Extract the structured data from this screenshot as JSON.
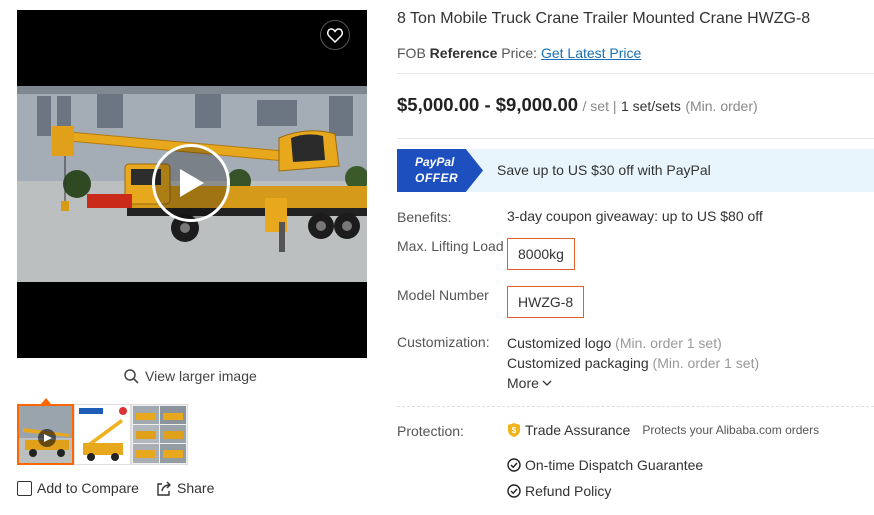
{
  "media": {
    "favorite_icon": "heart-icon",
    "play_icon": "play-icon",
    "view_larger": "View larger image",
    "thumbnails": [
      "video-thumbnail",
      "crane-image-thumbnail",
      "collage-thumbnail"
    ]
  },
  "actions": {
    "add_to_compare": "Add to Compare",
    "share": "Share"
  },
  "product": {
    "title": "8 Ton Mobile Truck Crane Trailer Mounted Crane HWZG-8",
    "fob_prefix": "FOB",
    "fob_bold": "Reference",
    "fob_suffix": "Price:",
    "latest_price_link": "Get Latest Price",
    "price_range": "$5,000.00 - $9,000.00",
    "price_unit": "/ set |",
    "moq": "1 set/sets",
    "moq_note": "(Min. order)"
  },
  "paypal": {
    "badge_line1": "PayPal",
    "badge_line2": "OFFER",
    "text": "Save up to US $30 off with PayPal",
    "color": "#1d4fbf"
  },
  "attributes": {
    "benefits_label": "Benefits:",
    "benefits_value": "3-day coupon giveaway: up to US $80 off",
    "lifting_label": "Max. Lifting Load",
    "lifting_value": "8000kg",
    "model_label": "Model Number",
    "model_value": "HWZG-8",
    "customization_label": "Customization:",
    "custom_logo": "Customized logo",
    "custom_logo_note": "(Min. order 1 set)",
    "custom_packaging": "Customized packaging",
    "custom_packaging_note": "(Min. order 1 set)",
    "more": "More"
  },
  "protection": {
    "label": "Protection:",
    "trade_assurance": "Trade Assurance",
    "trade_assurance_note": "Protects your Alibaba.com orders",
    "dispatch": "On-time Dispatch Guarantee",
    "refund": "Refund Policy"
  },
  "colors": {
    "accent_orange": "#f60",
    "box_border": "#e1622b",
    "link_blue": "#1a6fb5",
    "paypal_bg": "#e8f5fd"
  }
}
